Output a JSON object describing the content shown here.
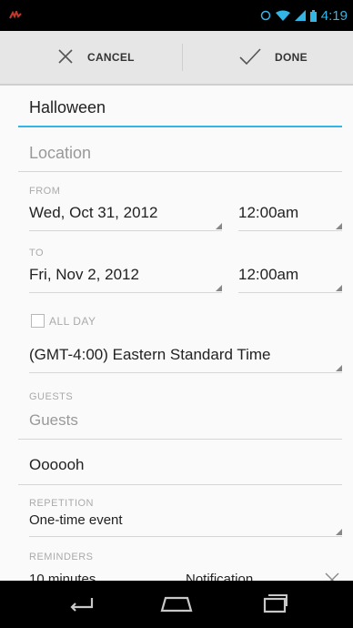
{
  "status_bar": {
    "time": "4:19",
    "icons": [
      "notification-icon",
      "alarm-icon",
      "wifi-icon",
      "signal-icon",
      "battery-icon"
    ]
  },
  "action_bar": {
    "cancel_label": "CANCEL",
    "done_label": "DONE"
  },
  "form": {
    "title_value": "Halloween",
    "location_placeholder": "Location",
    "from": {
      "label": "FROM",
      "date": "Wed, Oct 31, 2012",
      "time": "12:00am"
    },
    "to": {
      "label": "TO",
      "date": "Fri, Nov 2, 2012",
      "time": "12:00am"
    },
    "all_day_label": "ALL DAY",
    "all_day_checked": false,
    "timezone": "(GMT-4:00) Eastern Standard Time",
    "guests": {
      "label": "GUESTS",
      "placeholder": "Guests"
    },
    "description_value": "Oooooh",
    "repetition": {
      "label": "REPETITION",
      "value": "One-time event"
    },
    "reminders": {
      "label": "REMINDERS",
      "time": "10 minutes",
      "method": "Notification"
    }
  },
  "colors": {
    "accent": "#33b5e5",
    "status_bar": "#000000",
    "action_bar": "#e6e6e6"
  }
}
